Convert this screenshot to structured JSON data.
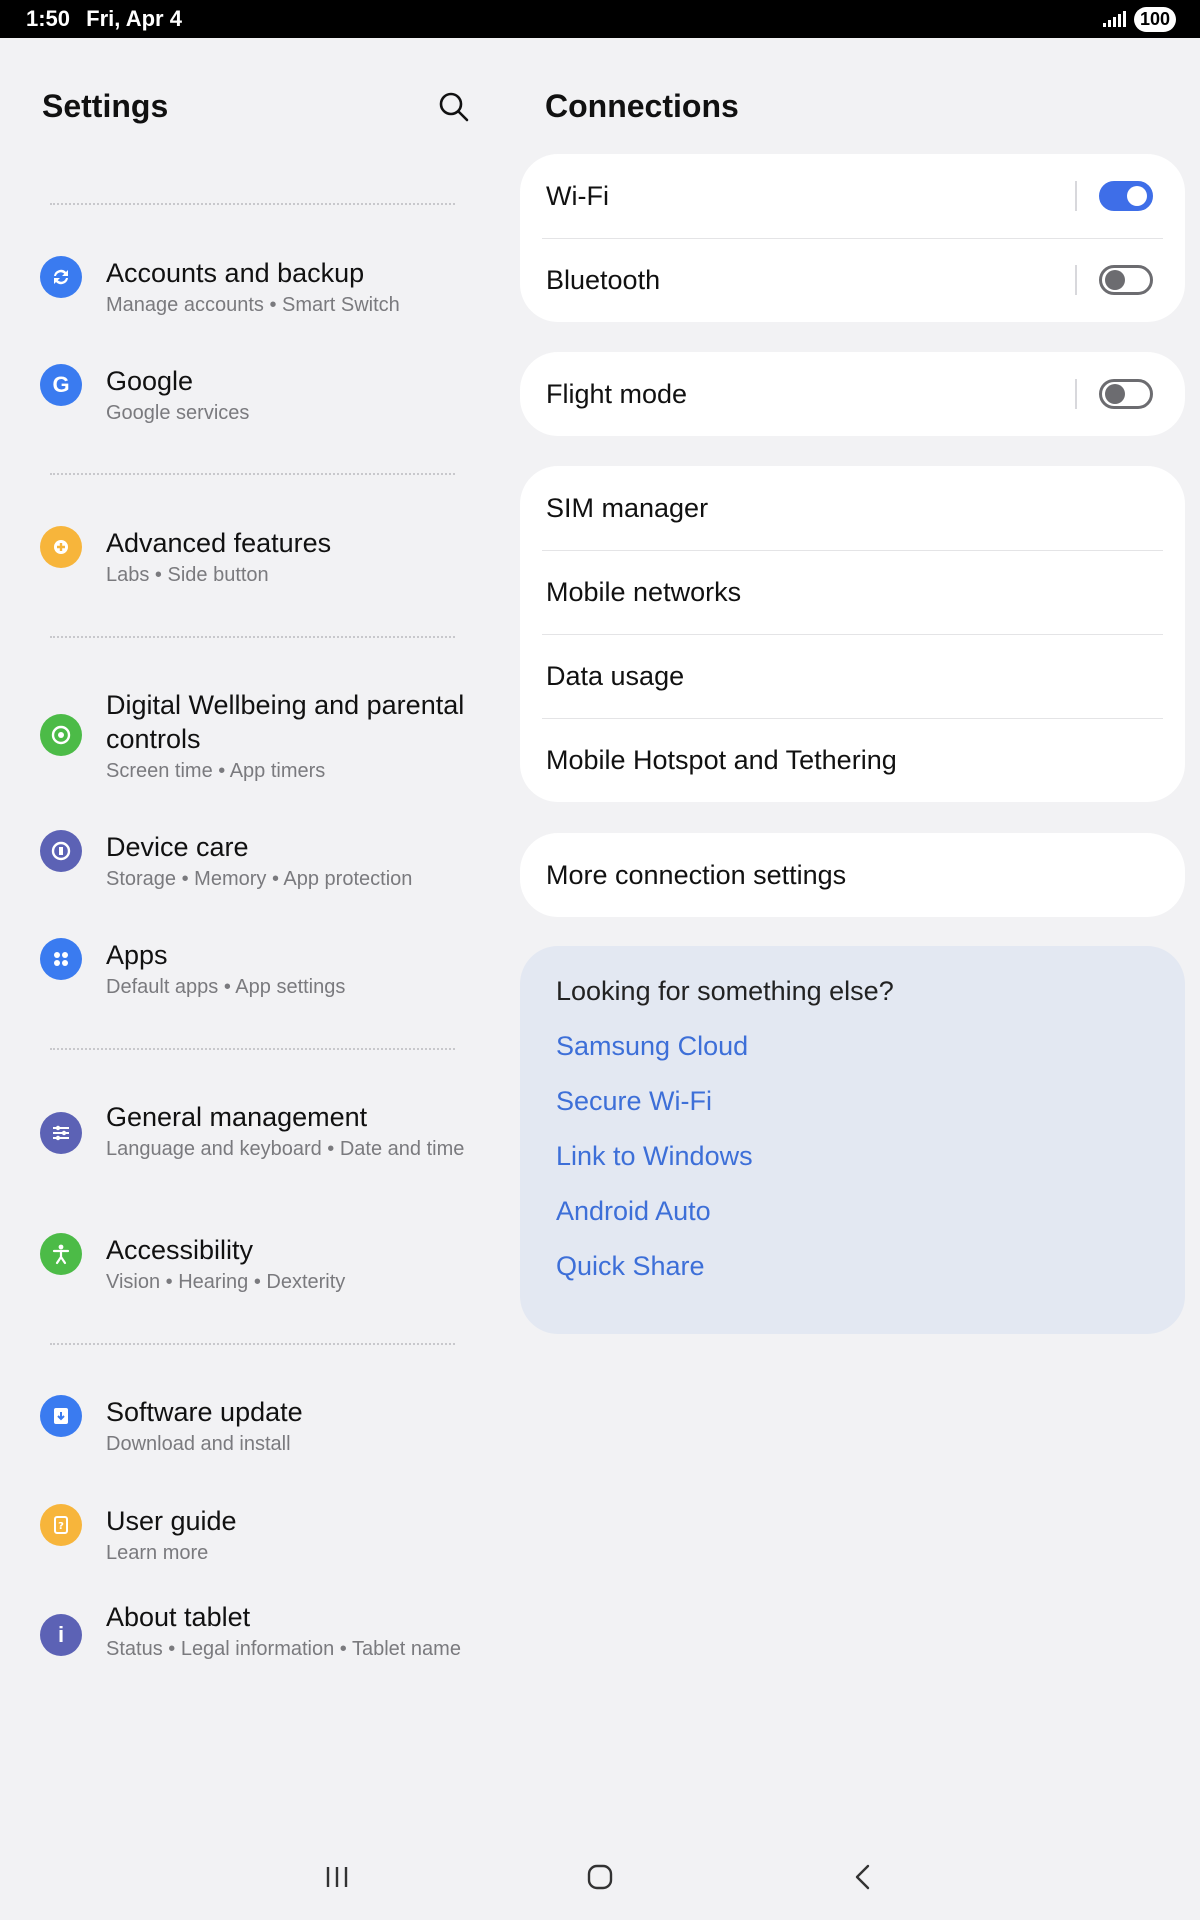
{
  "status": {
    "time": "1:50",
    "date": "Fri, Apr 4",
    "battery": "100"
  },
  "left": {
    "title": "Settings",
    "items": [
      {
        "title": "Accounts and backup",
        "sub": "Manage accounts  •  Smart Switch",
        "icon": "sync-icon",
        "color": "#3a7bf0"
      },
      {
        "title": "Google",
        "sub": "Google services",
        "icon": "google-icon",
        "color": "#3a7bf0"
      },
      {
        "title": "Advanced features",
        "sub": "Labs  •  Side button",
        "icon": "gear-plus-icon",
        "color": "#f7b53b"
      },
      {
        "title": "Digital Wellbeing and parental controls",
        "sub": "Screen time  •  App timers",
        "icon": "wellbeing-icon",
        "color": "#4cbb47"
      },
      {
        "title": "Device care",
        "sub": "Storage  •  Memory  •  App protection",
        "icon": "device-care-icon",
        "color": "#5c62b5"
      },
      {
        "title": "Apps",
        "sub": "Default apps  •  App settings",
        "icon": "apps-icon",
        "color": "#3a7bf0"
      },
      {
        "title": "General management",
        "sub": "Language and keyboard  •  Date and time",
        "icon": "sliders-icon",
        "color": "#5c62b5"
      },
      {
        "title": "Accessibility",
        "sub": "Vision  •  Hearing  •  Dexterity",
        "icon": "accessibility-icon",
        "color": "#4cbb47"
      },
      {
        "title": "Software update",
        "sub": "Download and install",
        "icon": "download-icon",
        "color": "#3a7bf0"
      },
      {
        "title": "User guide",
        "sub": "Learn more",
        "icon": "guide-icon",
        "color": "#f7b53b"
      },
      {
        "title": "About tablet",
        "sub": "Status  •  Legal information  •  Tablet name",
        "icon": "info-icon",
        "color": "#5c62b5"
      }
    ]
  },
  "right": {
    "title": "Connections",
    "card1": [
      {
        "label": "Wi-Fi",
        "toggle": true
      },
      {
        "label": "Bluetooth",
        "toggle": false
      }
    ],
    "card2": [
      {
        "label": "Flight mode",
        "toggle": false
      }
    ],
    "card3": [
      {
        "label": "SIM manager"
      },
      {
        "label": "Mobile networks"
      },
      {
        "label": "Data usage"
      },
      {
        "label": "Mobile Hotspot and Tethering"
      }
    ],
    "card4": [
      {
        "label": "More connection settings"
      }
    ],
    "suggest": {
      "title": "Looking for something else?",
      "links": [
        "Samsung Cloud",
        "Secure Wi-Fi",
        "Link to Windows",
        "Android Auto",
        "Quick Share"
      ]
    }
  },
  "colors": {
    "accent": "#3e6ee8",
    "link": "#3d6fd8"
  }
}
